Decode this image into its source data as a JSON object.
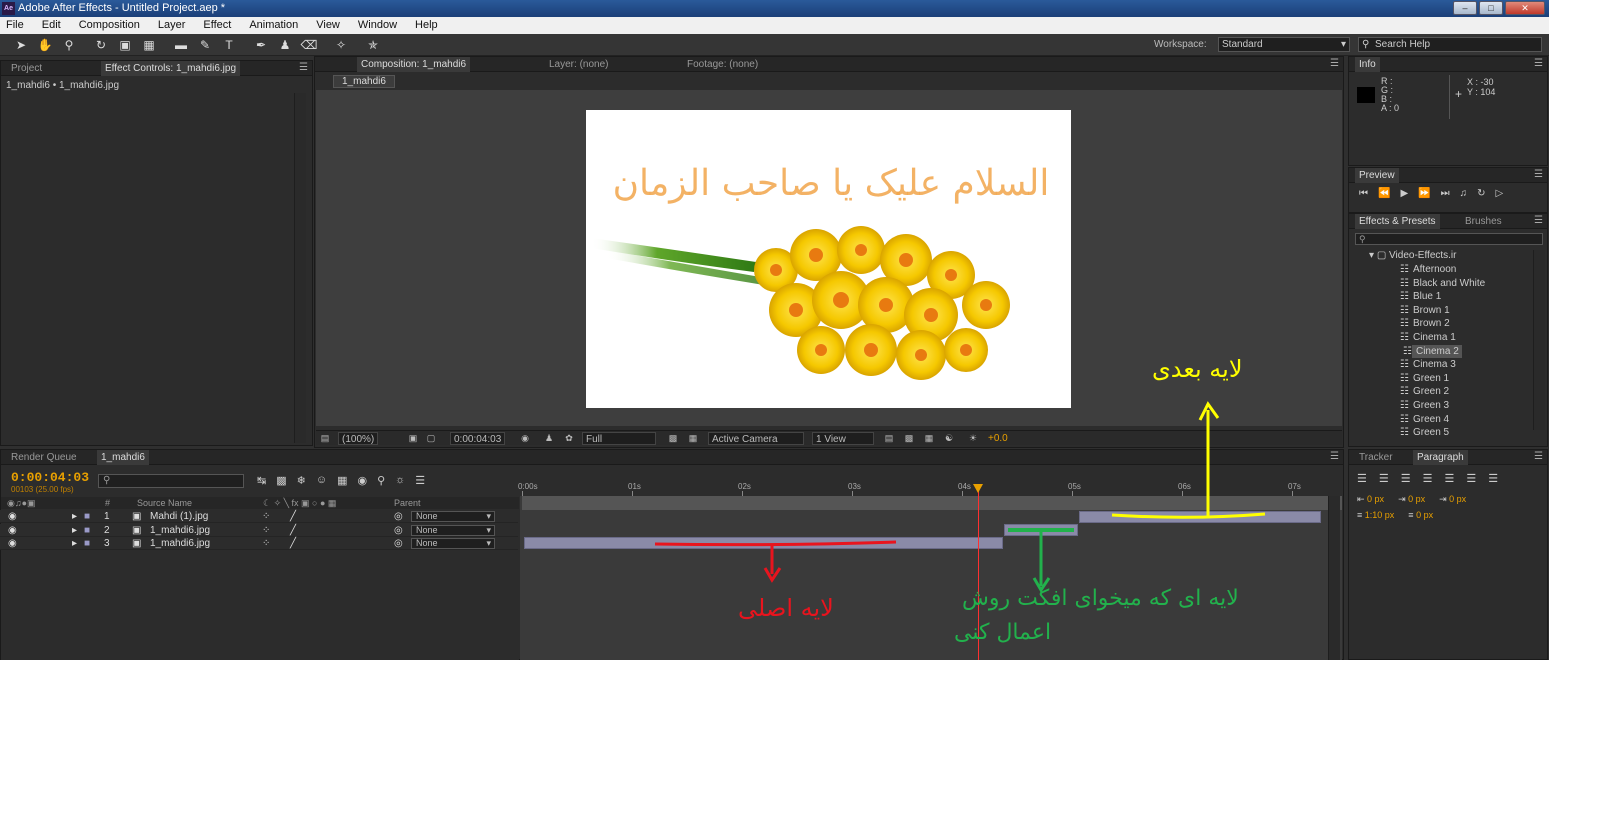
{
  "window": {
    "title": "Adobe After Effects - Untitled Project.aep *",
    "logo": "Ae"
  },
  "menu": [
    "File",
    "Edit",
    "Composition",
    "Layer",
    "Effect",
    "Animation",
    "View",
    "Window",
    "Help"
  ],
  "toolbar": {
    "workspace_label": "Workspace:",
    "workspace_value": "Standard",
    "search_placeholder": "Search Help"
  },
  "project_panel": {
    "tab_project": "Project",
    "tab_effect_controls": "Effect Controls: 1_mahdi6.jpg",
    "path": "1_mahdi6 • 1_mahdi6.jpg"
  },
  "composition_panel": {
    "tab_comp": "Composition: 1_mahdi6",
    "tab_layer": "Layer: (none)",
    "tab_footage": "Footage: (none)",
    "comp_chip": "1_mahdi6"
  },
  "viewer_bar": {
    "zoom": "(100%)",
    "time": "0:00:04:03",
    "resolution": "Full",
    "camera": "Active Camera",
    "views": "1 View",
    "exposure": "+0.0"
  },
  "info_panel": {
    "tab": "Info",
    "r": "R :",
    "g": "G :",
    "b": "B :",
    "a": "A : 0",
    "x": "X : -30",
    "y": "Y : 104"
  },
  "preview_panel": {
    "tab": "Preview"
  },
  "effects_panel": {
    "tab_effects": "Effects & Presets",
    "tab_brushes": "Brushes",
    "folder": "Video-Effects.ir",
    "items": [
      "Afternoon",
      "Black and White",
      "Blue 1",
      "Brown 1",
      "Brown 2",
      "Cinema 1",
      "Cinema 2",
      "Cinema 3",
      "Green 1",
      "Green 2",
      "Green 3",
      "Green 4",
      "Green 5"
    ],
    "selected_index": 6
  },
  "tracker_panel": {
    "tab_tracker": "Tracker",
    "tab_paragraph": "Paragraph",
    "indent_left": "0 px",
    "indent_mid": "0 px",
    "indent_right": "0 px",
    "space_before": "1:10 px",
    "space_after": "0 px"
  },
  "timeline": {
    "tab_render": "Render Queue",
    "tab_comp": "1_mahdi6",
    "timecode": "0:00:04:03",
    "fps": "00103 (25.00 fps)",
    "col_num": "#",
    "col_source": "Source Name",
    "col_parent": "Parent",
    "layers": [
      {
        "num": "1",
        "name": "Mahdi (1).jpg",
        "parent": "None"
      },
      {
        "num": "2",
        "name": "1_mahdi6.jpg",
        "parent": "None"
      },
      {
        "num": "3",
        "name": "1_mahdi6.jpg",
        "parent": "None"
      }
    ],
    "ruler": [
      "0:00s",
      "01s",
      "02s",
      "03s",
      "04s",
      "05s",
      "06s",
      "07s"
    ]
  },
  "annotations": {
    "next_layer": "لایه بعدی",
    "main_layer": "لایه اصلی",
    "effect_layer_1": "لایه ای که میخوای افکت روش",
    "effect_layer_2": "اعمال کنی"
  },
  "artwork": {
    "calligraphy": "السلام علیک یا صاحب الزمان"
  },
  "colors": {
    "timecode": "#e8a000",
    "cti": "#ff3030",
    "ann_red": "#e8141e",
    "ann_green": "#22b14c",
    "ann_yellow": "#ffff00"
  }
}
